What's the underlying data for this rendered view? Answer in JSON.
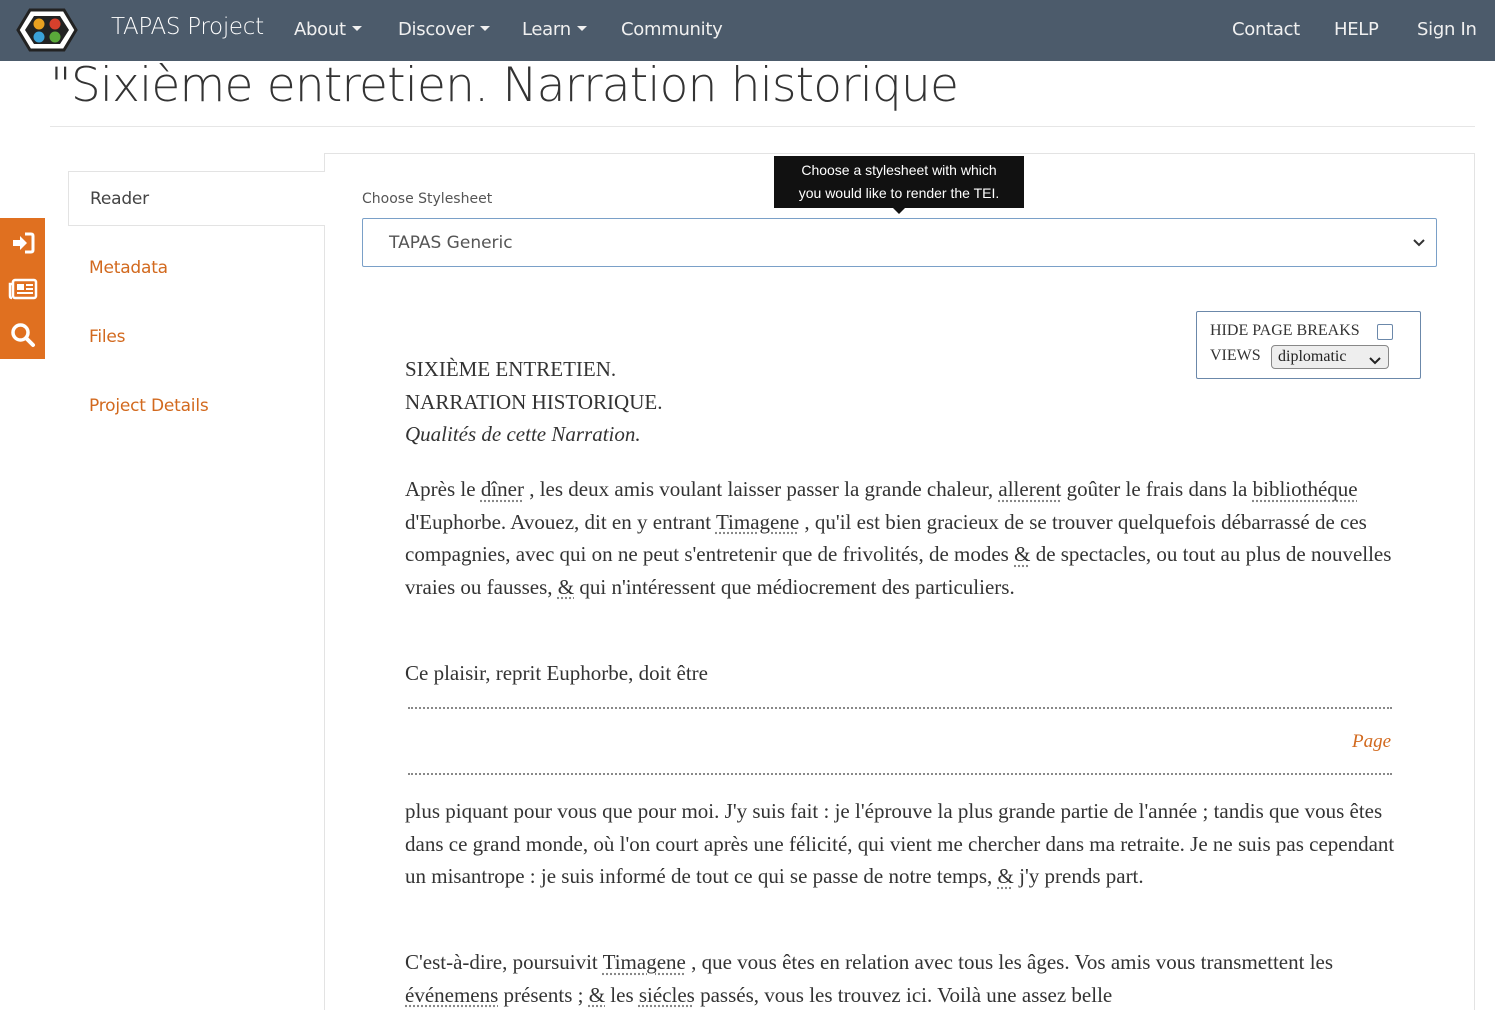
{
  "navbar": {
    "brand": "TAPAS Project",
    "items": [
      {
        "label": "About",
        "has_caret": true
      },
      {
        "label": "Discover",
        "has_caret": true
      },
      {
        "label": "Learn",
        "has_caret": true
      },
      {
        "label": "Community",
        "has_caret": false
      }
    ],
    "right_items": [
      {
        "label": "Contact"
      },
      {
        "label": "HELP"
      },
      {
        "label": "Sign In"
      }
    ],
    "background_color": "#4c5b6b"
  },
  "page": {
    "title": "\"Sixième entretien. Narration historique"
  },
  "side_toolbar": {
    "icons": [
      "sign-in-icon",
      "newspaper-icon",
      "search-icon"
    ],
    "color": "#e07020"
  },
  "tabs": [
    {
      "label": "Reader",
      "active": true
    },
    {
      "label": "Metadata",
      "active": false
    },
    {
      "label": "Files",
      "active": false
    },
    {
      "label": "Project Details",
      "active": false
    }
  ],
  "stylesheet": {
    "label": "Choose Stylesheet",
    "selected": "TAPAS Generic",
    "tooltip_line1": "Choose a stylesheet with which",
    "tooltip_line2": "you would like to render the TEI."
  },
  "view_controls": {
    "hide_page_breaks_label": "HIDE PAGE BREAKS",
    "hide_page_breaks_checked": false,
    "views_label": "VIEWS",
    "views_selected": "diplomatic"
  },
  "document": {
    "head1": "SIXIÈME ENTRETIEN.",
    "head2": "NARRATION HISTORIQUE.",
    "head3": "Qualités de cette Narration.",
    "p1": {
      "a": "Après le ",
      "w1": "dîner",
      "b": " , les deux amis voulant laisser passer la grande chaleur, ",
      "w2": "allerent",
      "c": " goûter le frais dans la ",
      "w3": "bibliothéque",
      "d": " d'Euphorbe. Avouez, dit en y entrant ",
      "w4": "Timagene",
      "e": " , qu'il est bien gracieux de se trouver quelquefois débarrassé de ces compagnies, avec qui on ne peut s'entretenir que de frivolités, de modes ",
      "w5": "&",
      "f": " de spectacles, ou tout au plus de nouvelles vraies ou fausses, ",
      "w6": "&",
      "g": " qui n'intéressent que médiocrement des particuliers."
    },
    "p2": "Ce plaisir, reprit Euphorbe, doit être",
    "page_marker": "Page",
    "p3": {
      "a": "plus piquant pour vous que pour moi. J'y suis fait : je l'éprouve la plus grande partie de l'année ; tandis que vous êtes dans ce grand monde, où l'on court après une félicité, qui vient me chercher dans ma retraite. Je ne suis pas cependant un misantrope : je suis informé de tout ce qui se passe de notre temps, ",
      "w1": "&",
      "b": " j'y prends part."
    },
    "p4": {
      "a": "C'est-à-dire, poursuivit ",
      "w1": "Timagene",
      "b": " , que vous êtes en relation avec tous les âges. Vos amis vous transmettent les ",
      "w2": "événemens",
      "c": " présents ; ",
      "w3": "&",
      "d": " les ",
      "w4": "siécles",
      "e": " passés, vous les trouvez ici. Voilà une assez belle"
    }
  }
}
